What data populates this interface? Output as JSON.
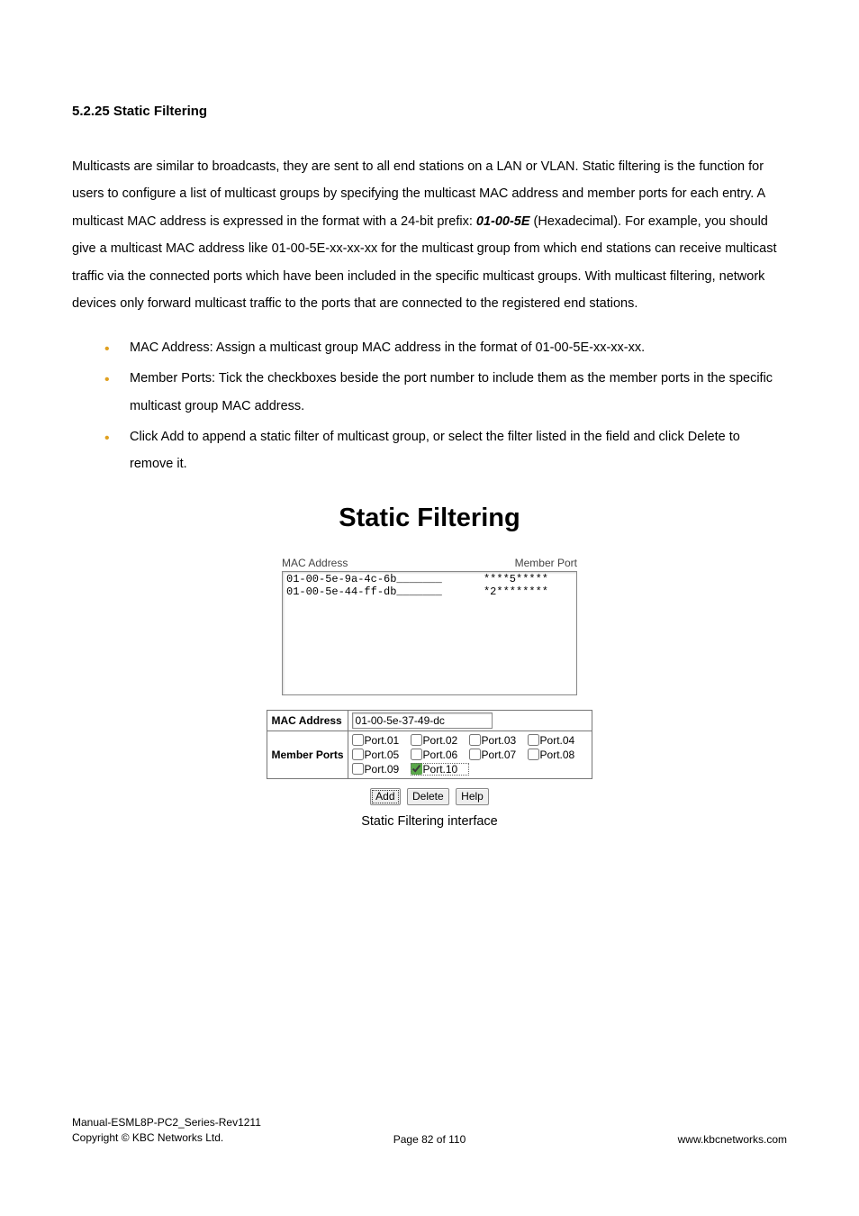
{
  "section": {
    "number": "5.2.25",
    "title": "Static Filtering"
  },
  "paragraph": {
    "pre": "Multicasts are similar to broadcasts, they are sent to all end stations on a LAN or VLAN. Static filtering is the function for users to configure a list of multicast groups by specifying the multicast MAC address and member ports for each entry. A multicast MAC address is expressed in the format with a 24-bit prefix: ",
    "prefix": "01-00-5E",
    "post": " (Hexadecimal). For example, you should give a multicast MAC address like 01-00-5E-xx-xx-xx for the multicast group from which end stations can receive multicast traffic via the connected ports which have been included in the specific multicast groups. With multicast filtering, network devices only forward multicast traffic to the ports that are connected to the registered end stations."
  },
  "bullets": [
    "MAC Address: Assign a multicast group MAC address in the format of 01-00-5E-xx-xx-xx.",
    "Member Ports: Tick the checkboxes beside the port number to include them as the member ports in the specific multicast group MAC address.",
    "Click Add to append a static filter of multicast group, or select the filter listed in the field and click Delete to remove it."
  ],
  "figure": {
    "title": "Static Filtering",
    "list_headers": {
      "mac": "MAC Address",
      "member": "Member Port"
    },
    "list_rows": [
      {
        "mac": "01-00-5e-9a-4c-6b_______",
        "mp": "****5*****"
      },
      {
        "mac": "01-00-5e-44-ff-db_______",
        "mp": "*2********"
      }
    ],
    "form": {
      "mac_label": "MAC Address",
      "mac_value": "01-00-5e-37-49-dc",
      "member_label": "Member Ports",
      "ports": [
        {
          "label": "Port.01",
          "checked": false
        },
        {
          "label": "Port.02",
          "checked": false
        },
        {
          "label": "Port.03",
          "checked": false
        },
        {
          "label": "Port.04",
          "checked": false
        },
        {
          "label": "Port.05",
          "checked": false
        },
        {
          "label": "Port.06",
          "checked": false
        },
        {
          "label": "Port.07",
          "checked": false
        },
        {
          "label": "Port.08",
          "checked": false
        },
        {
          "label": "Port.09",
          "checked": false
        },
        {
          "label": "Port.10",
          "checked": true
        }
      ]
    },
    "buttons": {
      "add": "Add",
      "delete": "Delete",
      "help": "Help"
    },
    "caption": "Static Filtering interface"
  },
  "footer": {
    "manual": "Manual-ESML8P-PC2_Series-Rev1211",
    "copyright": "Copyright © KBC Networks Ltd.",
    "page": "Page 82 of 110",
    "site": "www.kbcnetworks.com"
  }
}
